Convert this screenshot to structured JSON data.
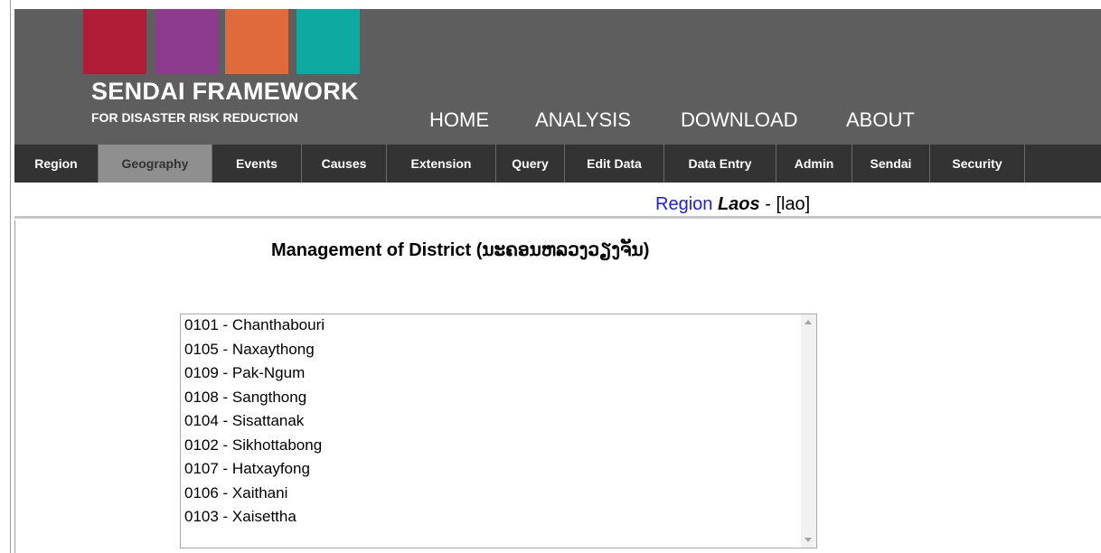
{
  "colors": {
    "header_bg": "#5e5e5e",
    "subnav_bg": "#333333",
    "subnav_active_bg": "#8f8f8f",
    "logo": [
      "#b01c35",
      "#8e3b8e",
      "#e16a3c",
      "#0eaaa2"
    ],
    "region_label": "#1a1aff"
  },
  "logo": {
    "title": "SENDAI FRAMEWORK",
    "subtitle": "FOR DISASTER RISK REDUCTION",
    "icon": "sendai-framework-logo-squares"
  },
  "topnav": [
    "HOME",
    "ANALYSIS",
    "DOWNLOAD",
    "ABOUT"
  ],
  "subnav": {
    "active": "Geography",
    "items": [
      "Region",
      "Geography",
      "Events",
      "Causes",
      "Extension",
      "Query",
      "Edit Data",
      "Data Entry",
      "Admin",
      "Sendai",
      "Security"
    ]
  },
  "region": {
    "label": "Region",
    "name": "Laos",
    "separator": "-",
    "code": "[lao]"
  },
  "page": {
    "title": "Management of District (ນະຄອນຫລວງວຽງຈັນ)"
  },
  "district_list": [
    "0101 - Chanthabouri",
    "0105 - Naxaythong",
    "0109 - Pak-Ngum",
    "0108 - Sangthong",
    "0104 - Sisattanak",
    "0102 - Sikhottabong",
    "0107 - Hatxayfong",
    "0106 - Xaithani",
    "0103 - Xaisettha"
  ]
}
